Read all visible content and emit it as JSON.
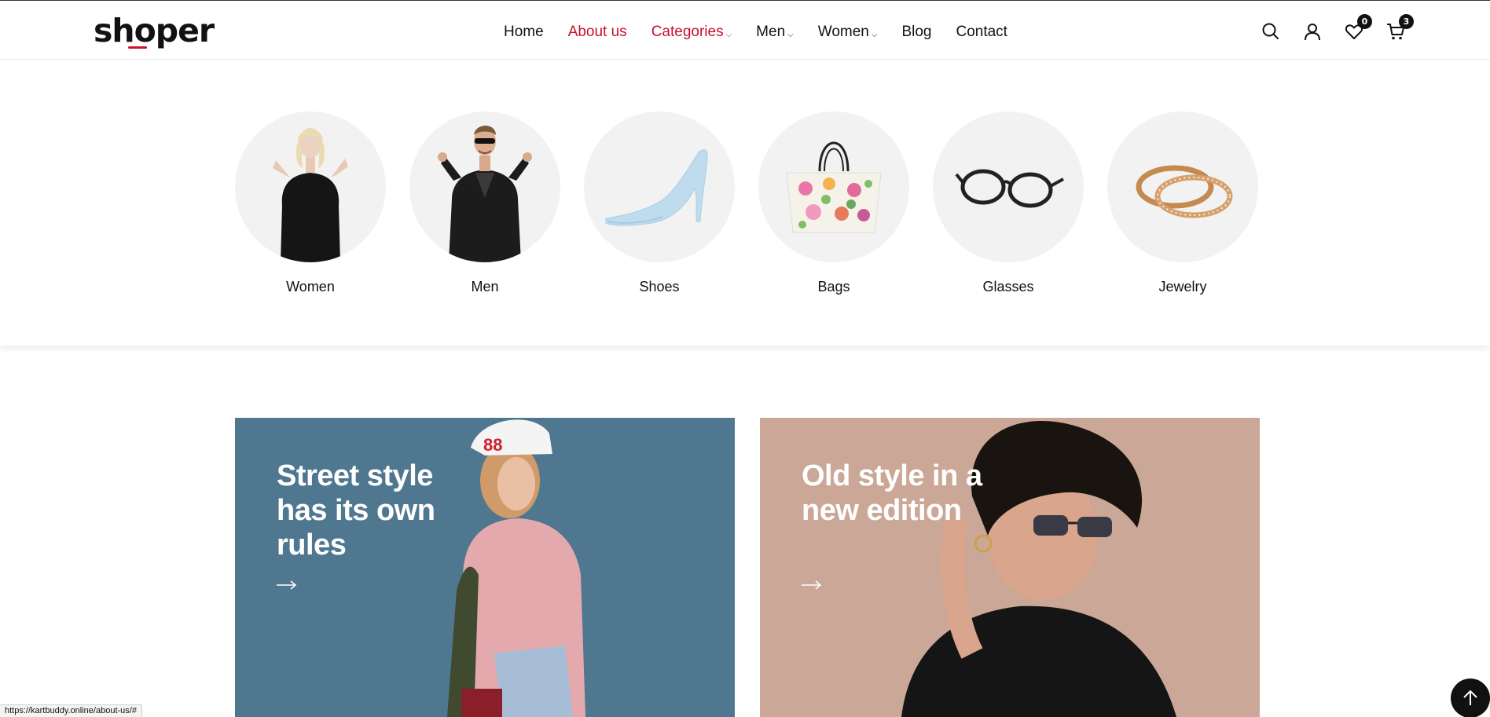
{
  "brand": {
    "logo_text": "shoper",
    "accent_color": "#c8102e"
  },
  "nav": {
    "items": [
      {
        "label": "Home",
        "active": false,
        "dropdown": false
      },
      {
        "label": "About us",
        "active": true,
        "dropdown": false
      },
      {
        "label": "Categories",
        "active": true,
        "dropdown": true
      },
      {
        "label": "Men",
        "active": false,
        "dropdown": true
      },
      {
        "label": "Women",
        "active": false,
        "dropdown": true
      },
      {
        "label": "Blog",
        "active": false,
        "dropdown": false
      },
      {
        "label": "Contact",
        "active": false,
        "dropdown": false
      }
    ],
    "chevron": "⌵"
  },
  "header_icons": {
    "search": "search-icon",
    "account": "user-icon",
    "wishlist": {
      "icon": "heart-icon",
      "count": "0"
    },
    "cart": {
      "icon": "cart-icon",
      "count": "3"
    }
  },
  "categories": [
    {
      "label": "Women",
      "icon": "women-model-image"
    },
    {
      "label": "Men",
      "icon": "men-model-image"
    },
    {
      "label": "Shoes",
      "icon": "high-heel-shoe-image"
    },
    {
      "label": "Bags",
      "icon": "floral-tote-bag-image"
    },
    {
      "label": "Glasses",
      "icon": "eyeglasses-image"
    },
    {
      "label": "Jewelry",
      "icon": "gold-rings-image"
    }
  ],
  "banners": [
    {
      "title": "Street style has its own rules",
      "background": "#4f7890",
      "arrow": "→"
    },
    {
      "title": "Old style in a new edition",
      "background": "#caa796",
      "arrow": "→"
    }
  ],
  "status_bar": {
    "url": "https://kartbuddy.online/about-us/#"
  },
  "back_to_top": {
    "icon": "arrow-up-icon"
  }
}
